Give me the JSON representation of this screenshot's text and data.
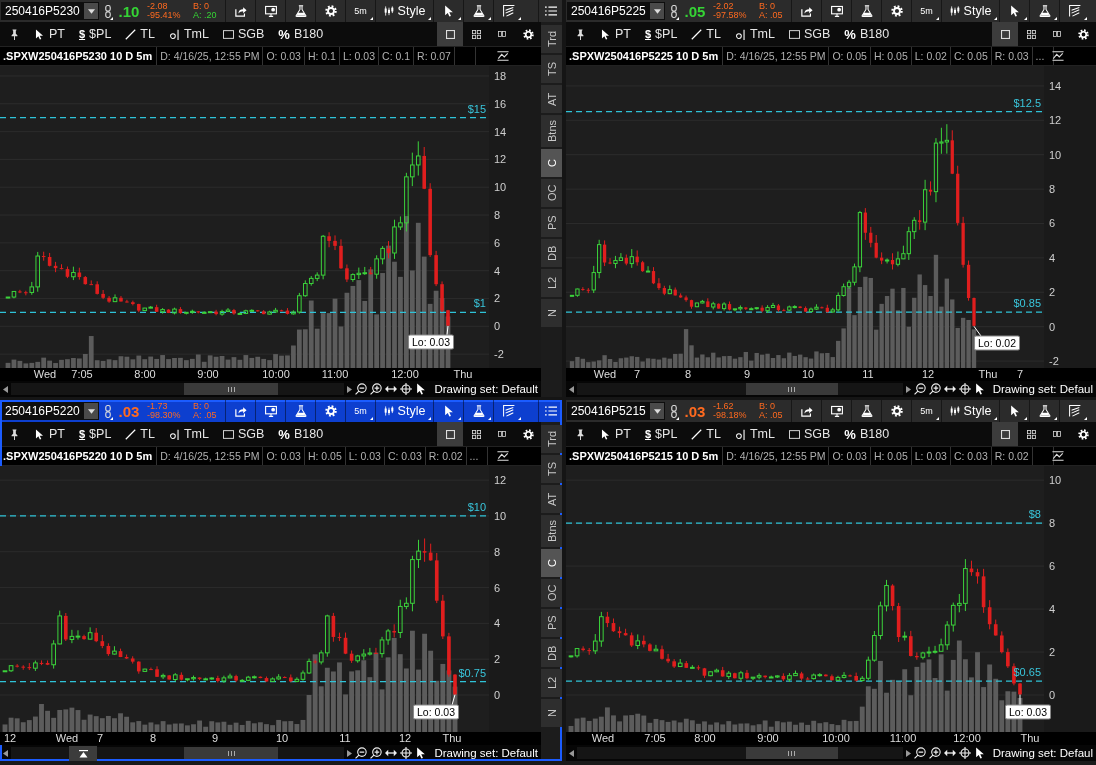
{
  "panels": [
    {
      "active": false,
      "toggle_shown": false,
      "header": {
        "symbol": "250416P5230",
        "last": {
          "text": ".10",
          "rising": true
        },
        "change": {
          "value": "-2.08",
          "percent": "-95.41%",
          "rising": false
        },
        "bid": {
          "text": "B: 0",
          "rising": false
        },
        "ask": {
          "text": "A: .20",
          "rising": true
        },
        "aggregation": "5m",
        "style": "Style",
        "menu": true
      },
      "toolbar": {
        "tools": [
          {
            "kind": "pin"
          },
          {
            "kind": "cursor",
            "label": "PT"
          },
          {
            "kind": "dollar",
            "glyph": "$",
            "label": "$PL"
          },
          {
            "kind": "line",
            "label": "TL"
          },
          {
            "kind": "timer",
            "label": "TmL"
          },
          {
            "kind": "rect",
            "label": "SGB"
          },
          {
            "kind": "percent",
            "glyph": "%",
            "label": "B180"
          }
        ],
        "layouts": [
          {
            "kind": "single",
            "selected": true
          },
          {
            "kind": "grid",
            "selected": false
          },
          {
            "kind": "compact",
            "selected": false
          }
        ]
      },
      "info": {
        "title": ".SPXW250416P5230 10 D 5m",
        "cells": [
          "D: 4/16/25, 12:55 PM",
          "O: 0.03",
          "H: 0.1",
          "L: 0.03",
          "C: 0.1",
          "R: 0.07"
        ]
      },
      "chart": {
        "y_axis_labels": [
          "18",
          "16",
          "14",
          "12",
          "10",
          "8",
          "6",
          "4",
          "2",
          "0",
          "-2"
        ],
        "price_lines": [
          {
            "label": "$15"
          },
          {
            "label": "$1"
          }
        ],
        "low_label": "Lo: 0.03",
        "x_axis_labels": [
          "Wed",
          "7:05",
          "8:00",
          "9:00",
          "10:00",
          "11:00",
          "12:00",
          "Thu"
        ]
      },
      "footer": {
        "drawing_set": "Drawing set: Default"
      },
      "sidebar_tabs": [
        {
          "label": "Trd",
          "selected": false
        },
        {
          "label": "TS",
          "selected": false
        },
        {
          "label": "AT",
          "selected": false
        },
        {
          "label": "Btns",
          "selected": false
        },
        {
          "label": "C",
          "selected": true
        },
        {
          "label": "OC",
          "selected": false
        },
        {
          "label": "PS",
          "selected": false
        },
        {
          "label": "DB",
          "selected": false
        },
        {
          "label": "L2",
          "selected": false
        },
        {
          "label": "N",
          "selected": false
        }
      ]
    },
    {
      "active": false,
      "toggle_shown": false,
      "header": {
        "symbol": "250416P5225",
        "last": {
          "text": ".05",
          "rising": true
        },
        "change": {
          "value": "-2.02",
          "percent": "-97.58%",
          "rising": false
        },
        "bid": {
          "text": "B: 0",
          "rising": false
        },
        "ask": {
          "text": "A: .05",
          "rising": false
        },
        "aggregation": "5m",
        "style": "Style",
        "menu": false
      },
      "toolbar": {
        "tools": [
          {
            "kind": "pin"
          },
          {
            "kind": "cursor",
            "label": "PT"
          },
          {
            "kind": "dollar",
            "glyph": "$",
            "label": "$PL"
          },
          {
            "kind": "line",
            "label": "TL"
          },
          {
            "kind": "timer",
            "label": "TmL"
          },
          {
            "kind": "rect",
            "label": "SGB"
          },
          {
            "kind": "percent",
            "glyph": "%",
            "label": "B180"
          }
        ],
        "layouts": [
          {
            "kind": "single",
            "selected": true
          },
          {
            "kind": "grid",
            "selected": false
          },
          {
            "kind": "compact",
            "selected": false
          }
        ]
      },
      "info": {
        "title": ".SPXW250416P5225 10 D 5m",
        "cells": [
          "D: 4/16/25, 12:55 PM",
          "O: 0.05",
          "H: 0.05",
          "L: 0.02",
          "C: 0.05",
          "R: 0.03"
        ],
        "more": "..."
      },
      "chart": {
        "y_axis_labels": [
          "14",
          "12",
          "10",
          "8",
          "6",
          "4",
          "2",
          "0",
          "-2"
        ],
        "price_lines": [
          {
            "label": "$12.5"
          },
          {
            "label": "$0.85"
          }
        ],
        "low_label": "Lo: 0.02",
        "x_axis_labels": [
          "Wed",
          "7",
          "8",
          "9",
          "10",
          "11",
          "12",
          "Thu",
          "7"
        ]
      },
      "footer": {
        "drawing_set": "Drawing set: Defaul"
      }
    },
    {
      "active": true,
      "toggle_shown": true,
      "header": {
        "symbol": "250416P5220",
        "last": {
          "text": ".03",
          "rising": false
        },
        "change": {
          "value": "-1.73",
          "percent": "-98.30%",
          "rising": false
        },
        "bid": {
          "text": "B: 0",
          "rising": false
        },
        "ask": {
          "text": "A: .05",
          "rising": false
        },
        "aggregation": "5m",
        "style": "Style",
        "menu": true
      },
      "toolbar": {
        "tools": [
          {
            "kind": "pin"
          },
          {
            "kind": "cursor",
            "label": "PT"
          },
          {
            "kind": "dollar",
            "glyph": "$",
            "label": "$PL"
          },
          {
            "kind": "line",
            "label": "TL"
          },
          {
            "kind": "timer",
            "label": "TmL"
          },
          {
            "kind": "rect",
            "label": "SGB"
          },
          {
            "kind": "percent",
            "glyph": "%",
            "label": "B180"
          }
        ],
        "layouts": [
          {
            "kind": "single",
            "selected": true
          },
          {
            "kind": "grid",
            "selected": false
          },
          {
            "kind": "compact",
            "selected": false
          }
        ]
      },
      "info": {
        "title": ".SPXW250416P5220 10 D 5m",
        "cells": [
          "D: 4/16/25, 12:55 PM",
          "O: 0.03",
          "H: 0.05",
          "L: 0.03",
          "C: 0.03",
          "R: 0.02"
        ],
        "more": "..."
      },
      "chart": {
        "y_axis_labels": [
          "12",
          "10",
          "8",
          "6",
          "4",
          "2",
          "0"
        ],
        "price_lines": [
          {
            "label": "$10"
          },
          {
            "label": "$0.75"
          }
        ],
        "low_label": "Lo: 0.03",
        "x_axis_labels": [
          "12",
          "Wed",
          "7",
          "8",
          "9",
          "10",
          "11",
          "12",
          "Thu"
        ]
      },
      "footer": {
        "drawing_set": "Drawing set: Default"
      },
      "sidebar_tabs": [
        {
          "label": "Trd",
          "selected": false
        },
        {
          "label": "TS",
          "selected": false
        },
        {
          "label": "AT",
          "selected": false
        },
        {
          "label": "Btns",
          "selected": false
        },
        {
          "label": "C",
          "selected": true
        },
        {
          "label": "OC",
          "selected": false
        },
        {
          "label": "PS",
          "selected": false
        },
        {
          "label": "DB",
          "selected": false
        },
        {
          "label": "L2",
          "selected": false
        },
        {
          "label": "N",
          "selected": false
        }
      ]
    },
    {
      "active": false,
      "toggle_shown": false,
      "header": {
        "symbol": "250416P5215",
        "last": {
          "text": ".03",
          "rising": false
        },
        "change": {
          "value": "-1.62",
          "percent": "-98.18%",
          "rising": false
        },
        "bid": {
          "text": "B: 0",
          "rising": false
        },
        "ask": {
          "text": "A: .05",
          "rising": false
        },
        "aggregation": "5m",
        "style": "Style",
        "menu": false
      },
      "toolbar": {
        "tools": [
          {
            "kind": "pin"
          },
          {
            "kind": "cursor",
            "label": "PT"
          },
          {
            "kind": "dollar",
            "glyph": "$",
            "label": "$PL"
          },
          {
            "kind": "line",
            "label": "TL"
          },
          {
            "kind": "timer",
            "label": "TmL"
          },
          {
            "kind": "rect",
            "label": "SGB"
          },
          {
            "kind": "percent",
            "glyph": "%",
            "label": "B180"
          }
        ],
        "layouts": [
          {
            "kind": "single",
            "selected": true
          },
          {
            "kind": "grid",
            "selected": false
          },
          {
            "kind": "compact",
            "selected": false
          }
        ]
      },
      "info": {
        "title": ".SPXW250416P5215 10 D 5m",
        "cells": [
          "D: 4/16/25, 12:55 PM",
          "O: 0.03",
          "H: 0.05",
          "L: 0.03",
          "C: 0.03",
          "R: 0.02"
        ]
      },
      "chart": {
        "y_axis_labels": [
          "10",
          "8",
          "6",
          "4",
          "2",
          "0"
        ],
        "price_lines": [
          {
            "label": "$8"
          },
          {
            "label": "$0.65"
          }
        ],
        "low_label": "Lo: 0.03",
        "x_axis_labels": [
          "Wed",
          "7:05",
          "8:00",
          "9:00",
          "10:00",
          "11:00",
          "12:00",
          "Thu"
        ]
      },
      "footer": {
        "drawing_set": "Drawing set: Defaul"
      }
    }
  ]
}
